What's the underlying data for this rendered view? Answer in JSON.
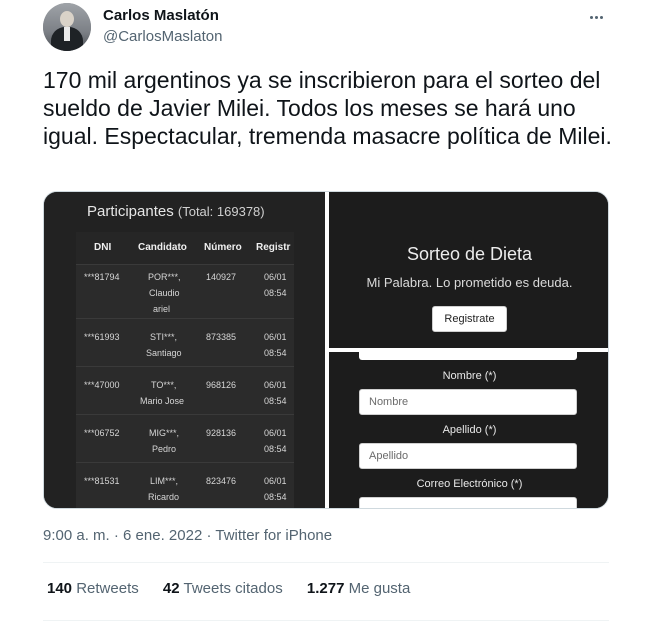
{
  "author": {
    "name": "Carlos Maslatón",
    "handle": "@CarlosMaslaton"
  },
  "tweet_text": "170 mil argentinos ya se inscribieron para el sorteo del sueldo de Javier Milei. Todos los meses se hará uno igual. Espectacular, tremenda masacre política de Milei.",
  "media": {
    "participants": {
      "title": "Participantes",
      "total": "(Total: 169378)",
      "headers": [
        "DNI",
        "Candidato",
        "Número",
        "Registr"
      ],
      "rows": [
        {
          "dni": "***81794",
          "cand1": "POR***,",
          "cand2": "Claudio",
          "cand3": "ariel",
          "num": "140927",
          "date": "06/01",
          "time": "08:54"
        },
        {
          "dni": "***61993",
          "cand1": "STI***,",
          "cand2": "Santiago",
          "cand3": "",
          "num": "873385",
          "date": "06/01",
          "time": "08:54"
        },
        {
          "dni": "***47000",
          "cand1": "TO***,",
          "cand2": "Mario Jose",
          "cand3": "",
          "num": "968126",
          "date": "06/01",
          "time": "08:54"
        },
        {
          "dni": "***06752",
          "cand1": "MIG***,",
          "cand2": "Pedro",
          "cand3": "",
          "num": "928136",
          "date": "06/01",
          "time": "08:54"
        },
        {
          "dni": "***81531",
          "cand1": "LIM***,",
          "cand2": "Ricardo",
          "cand3": "",
          "num": "823476",
          "date": "06/01",
          "time": "08:54"
        }
      ]
    },
    "sorteo": {
      "title": "Sorteo de Dieta",
      "subtitle": "Mi Palabra. Lo prometido es deuda.",
      "button": "Registrate"
    },
    "form": {
      "nombre_label": "Nombre (*)",
      "nombre_placeholder": "Nombre",
      "apellido_label": "Apellido (*)",
      "apellido_placeholder": "Apellido",
      "correo_label": "Correo Electrónico (*)"
    }
  },
  "meta": {
    "time": "9:00 a. m.",
    "dot": "·",
    "date": "6 ene. 2022",
    "source": "Twitter for iPhone"
  },
  "stats": {
    "retweets_count": "140",
    "retweets_label": "Retweets",
    "quotes_count": "42",
    "quotes_label": "Tweets citados",
    "likes_count": "1.277",
    "likes_label": "Me gusta"
  }
}
